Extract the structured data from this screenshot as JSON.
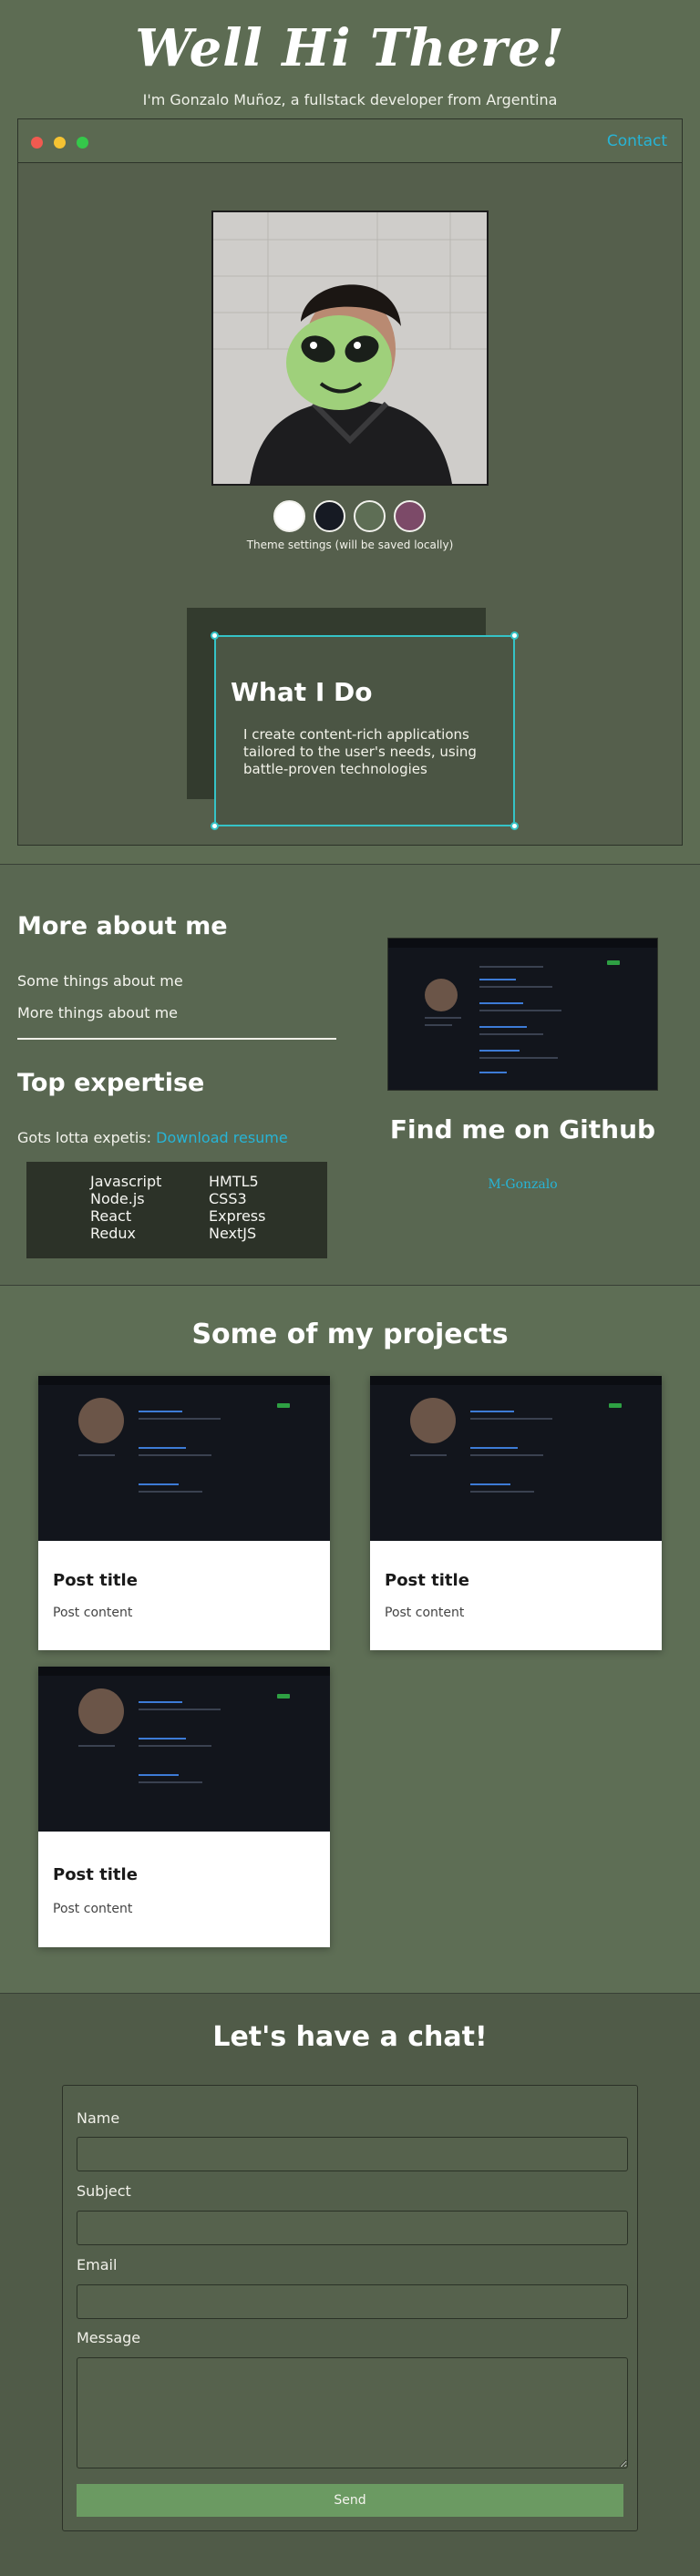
{
  "hero": {
    "title": "Well Hi There!",
    "subtitle": "I'm Gonzalo Muñoz, a fullstack developer from Argentina"
  },
  "window": {
    "contact_label": "Contact",
    "theme_note": "Theme settings (will be saved locally)",
    "themes": [
      {
        "name": "light",
        "color": "#ffffff"
      },
      {
        "name": "dark",
        "color": "#161a23"
      },
      {
        "name": "olive",
        "color": "#5e6e55"
      },
      {
        "name": "plum",
        "color": "#7c4a68"
      }
    ],
    "whatido": {
      "title": "What I Do",
      "text": "I create content-rich applications tailored to the user's needs, using battle-proven technologies"
    }
  },
  "about": {
    "title": "More about me",
    "links": [
      "Some things about me",
      "More things about me"
    ],
    "expertise_title": "Top expertise",
    "expertise_note": "Gots lotta expetis: ",
    "resume_label": "Download resume",
    "skills_left": [
      "Javascript",
      "Node.js",
      "React",
      "Redux"
    ],
    "skills_right": [
      "HMTL5",
      "CSS3",
      "Express",
      "NextJS"
    ],
    "github_title": "Find me on Github",
    "github_user": "M-Gonzalo"
  },
  "projects": {
    "title": "Some of my projects",
    "cards": [
      {
        "title": "Post title",
        "content": "Post content"
      },
      {
        "title": "Post title",
        "content": "Post content"
      },
      {
        "title": "Post title",
        "content": "Post content"
      }
    ]
  },
  "chat": {
    "title": "Let's have a chat!",
    "fields": {
      "name_label": "Name",
      "subject_label": "Subject",
      "email_label": "Email",
      "message_label": "Message"
    },
    "send_label": "Send"
  },
  "colors": {
    "accent": "#27b4d6",
    "selection": "#35c3c7",
    "send": "#6b9a62"
  }
}
